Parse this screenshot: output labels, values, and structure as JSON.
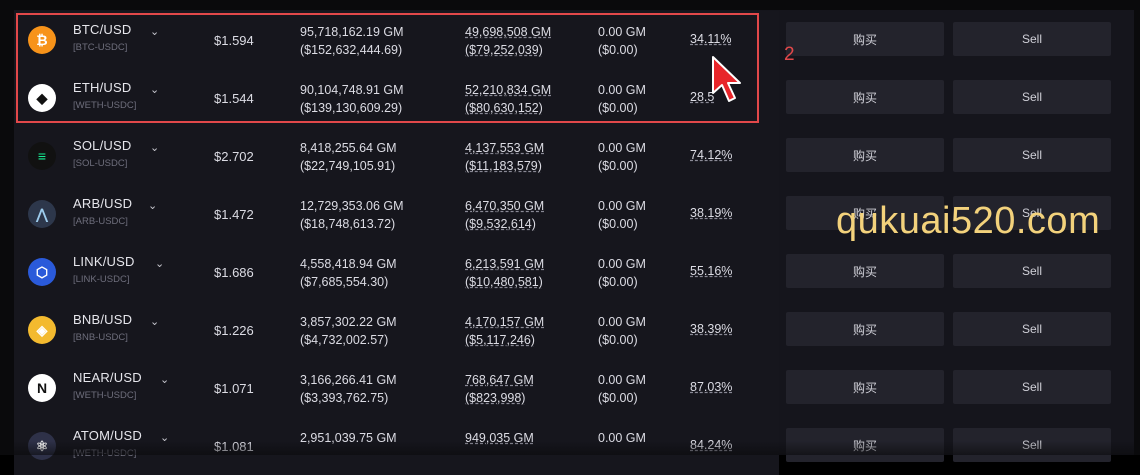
{
  "rows": [
    {
      "pair": "BTC/USD",
      "sub": "[BTC-USDC]",
      "price": "$1.594",
      "col1_line1": "95,718,162.19 GM",
      "col1_line2": "($152,632,444.69)",
      "col2_line1": "49,698,508 GM",
      "col2_line2": "($79,252,039)",
      "col3_line1": "0.00 GM",
      "col3_line2": "($0.00)",
      "percent": "34.11%",
      "buy_label": "购买",
      "sell_label": "Sell",
      "icon": "bitcoin-icon",
      "icon_color": "#f7931a",
      "icon_glyph": "₿"
    },
    {
      "pair": "ETH/USD",
      "sub": "[WETH-USDC]",
      "price": "$1.544",
      "col1_line1": "90,104,748.91 GM",
      "col1_line2": "($139,130,609.29)",
      "col2_line1": "52,210,834 GM",
      "col2_line2": "($80,630,152)",
      "col3_line1": "0.00 GM",
      "col3_line2": "($0.00)",
      "percent": "28.5",
      "buy_label": "购买",
      "sell_label": "Sell",
      "icon": "ethereum-icon",
      "icon_color": "#ffffff",
      "icon_glyph": "◆"
    },
    {
      "pair": "SOL/USD",
      "sub": "[SOL-USDC]",
      "price": "$2.702",
      "col1_line1": "8,418,255.64 GM",
      "col1_line2": "($22,749,105.91)",
      "col2_line1": "4,137,553 GM",
      "col2_line2": "($11,183,579)",
      "col3_line1": "0.00 GM",
      "col3_line2": "($0.00)",
      "percent": "74.12%",
      "buy_label": "购买",
      "sell_label": "Sell",
      "icon": "solana-icon",
      "icon_color": "#111111",
      "icon_glyph": "≡"
    },
    {
      "pair": "ARB/USD",
      "sub": "[ARB-USDC]",
      "price": "$1.472",
      "col1_line1": "12,729,353.06 GM",
      "col1_line2": "($18,748,613.72)",
      "col2_line1": "6,470,350 GM",
      "col2_line2": "($9,532,614)",
      "col3_line1": "0.00 GM",
      "col3_line2": "($0.00)",
      "percent": "38.19%",
      "buy_label": "购买",
      "sell_label": "Sell",
      "icon": "arbitrum-icon",
      "icon_color": "#2d374b",
      "icon_glyph": "⋀"
    },
    {
      "pair": "LINK/USD",
      "sub": "[LINK-USDC]",
      "price": "$1.686",
      "col1_line1": "4,558,418.94 GM",
      "col1_line2": "($7,685,554.30)",
      "col2_line1": "6,213,591 GM",
      "col2_line2": "($10,480,581)",
      "col3_line1": "0.00 GM",
      "col3_line2": "($0.00)",
      "percent": "55.16%",
      "buy_label": "购买",
      "sell_label": "Sell",
      "icon": "chainlink-icon",
      "icon_color": "#2a5ada",
      "icon_glyph": "⬡"
    },
    {
      "pair": "BNB/USD",
      "sub": "[BNB-USDC]",
      "price": "$1.226",
      "col1_line1": "3,857,302.22 GM",
      "col1_line2": "($4,732,002.57)",
      "col2_line1": "4,170,157 GM",
      "col2_line2": "($5,117,246)",
      "col3_line1": "0.00 GM",
      "col3_line2": "($0.00)",
      "percent": "38.39%",
      "buy_label": "购买",
      "sell_label": "Sell",
      "icon": "bnb-icon",
      "icon_color": "#f3ba2f",
      "icon_glyph": "◈"
    },
    {
      "pair": "NEAR/USD",
      "sub": "[WETH-USDC]",
      "price": "$1.071",
      "col1_line1": "3,166,266.41 GM",
      "col1_line2": "($3,393,762.75)",
      "col2_line1": "768,647 GM",
      "col2_line2": "($823,998)",
      "col3_line1": "0.00 GM",
      "col3_line2": "($0.00)",
      "percent": "87.03%",
      "buy_label": "购买",
      "sell_label": "Sell",
      "icon": "near-icon",
      "icon_color": "#ffffff",
      "icon_glyph": "N"
    },
    {
      "pair": "ATOM/USD",
      "sub": "[WETH-USDC]",
      "price": "$1.081",
      "col1_line1": "2,951,039.75 GM",
      "col1_line2": "",
      "col2_line1": "949,035 GM",
      "col2_line2": "",
      "col3_line1": "0.00 GM",
      "col3_line2": "",
      "percent": "84.24%",
      "buy_label": "购买",
      "sell_label": "Sell",
      "icon": "cosmos-icon",
      "icon_color": "#2e3148",
      "icon_glyph": "⚛"
    }
  ],
  "annotation": {
    "step_number": "2"
  },
  "watermark": "qukuai520.com",
  "colors": {
    "highlight": "#e2484a",
    "watermark": "#f3d27c",
    "background": "#15151c",
    "button": "#23232c"
  }
}
